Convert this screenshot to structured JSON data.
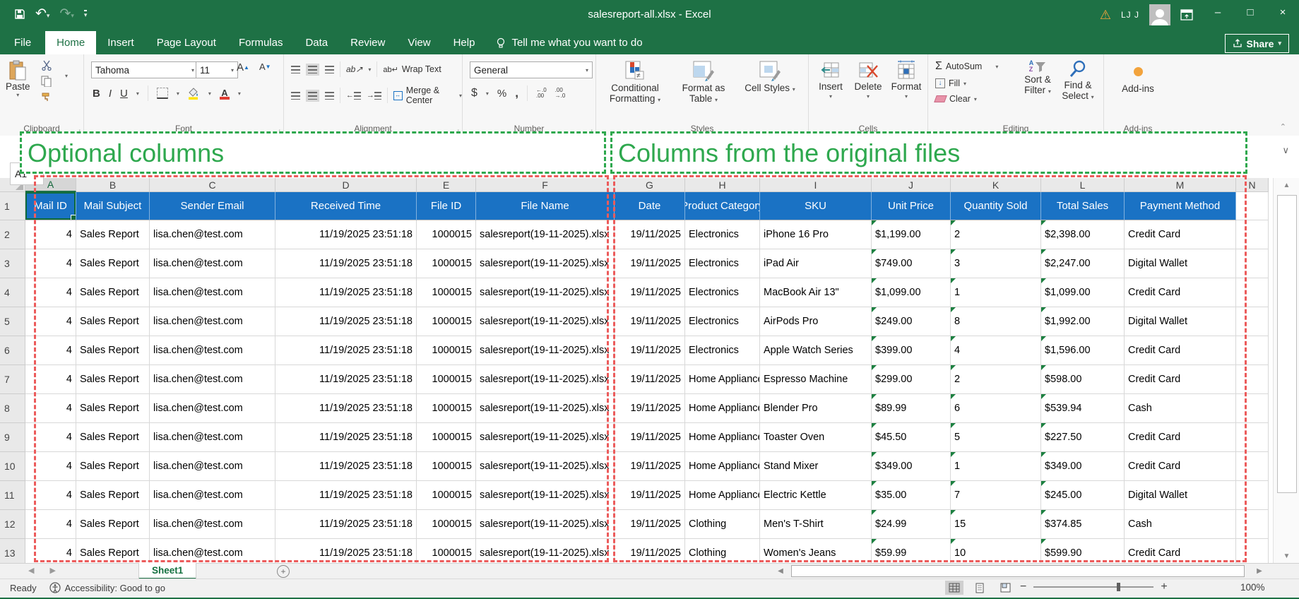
{
  "titlebar": {
    "title": "salesreport-all.xlsx - Excel",
    "user_initials": "LJ J",
    "minimize": "–",
    "maximize": "□",
    "close": "×"
  },
  "tabs": [
    "File",
    "Home",
    "Insert",
    "Page Layout",
    "Formulas",
    "Data",
    "Review",
    "View",
    "Help"
  ],
  "tellme": "Tell me what you want to do",
  "share_label": "Share",
  "ribbon": {
    "group_labels": {
      "clipboard": "Clipboard",
      "font": "Font",
      "alignment": "Alignment",
      "number": "Number",
      "styles": "Styles",
      "cells": "Cells",
      "editing": "Editing",
      "addins": "Add-ins"
    },
    "paste": "Paste",
    "font_name": "Tahoma",
    "font_size": "11",
    "wrap_text": "Wrap Text",
    "merge_center": "Merge & Center",
    "number_format": "General",
    "cond_formatting": "Conditional Formatting",
    "format_as_table": "Format as Table",
    "cell_styles": "Cell Styles",
    "insert": "Insert",
    "delete": "Delete",
    "format": "Format",
    "autosum": "AutoSum",
    "fill": "Fill",
    "clear": "Clear",
    "sort_filter": "Sort & Filter",
    "find_select": "Find & Select",
    "addins": "Add-ins"
  },
  "annotations": {
    "optional": "Optional columns",
    "original": "Columns from the original files"
  },
  "name_box": "A1",
  "grid": {
    "col_letters": [
      "A",
      "B",
      "C",
      "D",
      "E",
      "F",
      "G",
      "H",
      "I",
      "J",
      "K",
      "L",
      "M",
      "N"
    ],
    "headers": [
      "Mail ID",
      "Mail Subject",
      "Sender Email",
      "Received Time",
      "File ID",
      "File Name",
      "Date",
      "Product Category",
      "SKU",
      "Unit Price",
      "Quantity Sold",
      "Total Sales",
      "Payment Method"
    ],
    "row_numbers": [
      1,
      2,
      3,
      4,
      5,
      6,
      7,
      8,
      9,
      10,
      11,
      12,
      13
    ],
    "rows": [
      [
        "4",
        "Sales Report",
        "lisa.chen@test.com",
        "11/19/2025 23:51:18",
        "1000015",
        "salesreport(19-11-2025).xlsx",
        "19/11/2025",
        "Electronics",
        "iPhone 16 Pro",
        "$1,199.00",
        "2",
        "$2,398.00",
        "Credit Card"
      ],
      [
        "4",
        "Sales Report",
        "lisa.chen@test.com",
        "11/19/2025 23:51:18",
        "1000015",
        "salesreport(19-11-2025).xlsx",
        "19/11/2025",
        "Electronics",
        "iPad Air",
        "$749.00",
        "3",
        "$2,247.00",
        "Digital Wallet"
      ],
      [
        "4",
        "Sales Report",
        "lisa.chen@test.com",
        "11/19/2025 23:51:18",
        "1000015",
        "salesreport(19-11-2025).xlsx",
        "19/11/2025",
        "Electronics",
        "MacBook Air 13\"",
        "$1,099.00",
        "1",
        "$1,099.00",
        "Credit Card"
      ],
      [
        "4",
        "Sales Report",
        "lisa.chen@test.com",
        "11/19/2025 23:51:18",
        "1000015",
        "salesreport(19-11-2025).xlsx",
        "19/11/2025",
        "Electronics",
        "AirPods Pro",
        "$249.00",
        "8",
        "$1,992.00",
        "Digital Wallet"
      ],
      [
        "4",
        "Sales Report",
        "lisa.chen@test.com",
        "11/19/2025 23:51:18",
        "1000015",
        "salesreport(19-11-2025).xlsx",
        "19/11/2025",
        "Electronics",
        "Apple Watch Series",
        "$399.00",
        "4",
        "$1,596.00",
        "Credit Card"
      ],
      [
        "4",
        "Sales Report",
        "lisa.chen@test.com",
        "11/19/2025 23:51:18",
        "1000015",
        "salesreport(19-11-2025).xlsx",
        "19/11/2025",
        "Home Appliances",
        "Espresso Machine",
        "$299.00",
        "2",
        "$598.00",
        "Credit Card"
      ],
      [
        "4",
        "Sales Report",
        "lisa.chen@test.com",
        "11/19/2025 23:51:18",
        "1000015",
        "salesreport(19-11-2025).xlsx",
        "19/11/2025",
        "Home Appliances",
        "Blender Pro",
        "$89.99",
        "6",
        "$539.94",
        "Cash"
      ],
      [
        "4",
        "Sales Report",
        "lisa.chen@test.com",
        "11/19/2025 23:51:18",
        "1000015",
        "salesreport(19-11-2025).xlsx",
        "19/11/2025",
        "Home Appliances",
        "Toaster Oven",
        "$45.50",
        "5",
        "$227.50",
        "Credit Card"
      ],
      [
        "4",
        "Sales Report",
        "lisa.chen@test.com",
        "11/19/2025 23:51:18",
        "1000015",
        "salesreport(19-11-2025).xlsx",
        "19/11/2025",
        "Home Appliances",
        "Stand Mixer",
        "$349.00",
        "1",
        "$349.00",
        "Credit Card"
      ],
      [
        "4",
        "Sales Report",
        "lisa.chen@test.com",
        "11/19/2025 23:51:18",
        "1000015",
        "salesreport(19-11-2025).xlsx",
        "19/11/2025",
        "Home Appliances",
        "Electric Kettle",
        "$35.00",
        "7",
        "$245.00",
        "Digital Wallet"
      ],
      [
        "4",
        "Sales Report",
        "lisa.chen@test.com",
        "11/19/2025 23:51:18",
        "1000015",
        "salesreport(19-11-2025).xlsx",
        "19/11/2025",
        "Clothing",
        "Men's T-Shirt",
        "$24.99",
        "15",
        "$374.85",
        "Cash"
      ],
      [
        "4",
        "Sales Report",
        "lisa.chen@test.com",
        "11/19/2025 23:51:18",
        "1000015",
        "salesreport(19-11-2025).xlsx",
        "19/11/2025",
        "Clothing",
        "Women's Jeans",
        "$59.99",
        "10",
        "$599.90",
        "Credit Card"
      ]
    ]
  },
  "sheet": {
    "active_tab": "Sheet1"
  },
  "status": {
    "ready": "Ready",
    "accessibility": "Accessibility: Good to go",
    "zoom": "100%"
  },
  "colors": {
    "excel_green": "#1E7145",
    "header_blue": "#1A72C4",
    "annotation_green": "#2EA84E",
    "annotation_red": "#EC5B5B",
    "error_triangle": "#1C8040"
  }
}
